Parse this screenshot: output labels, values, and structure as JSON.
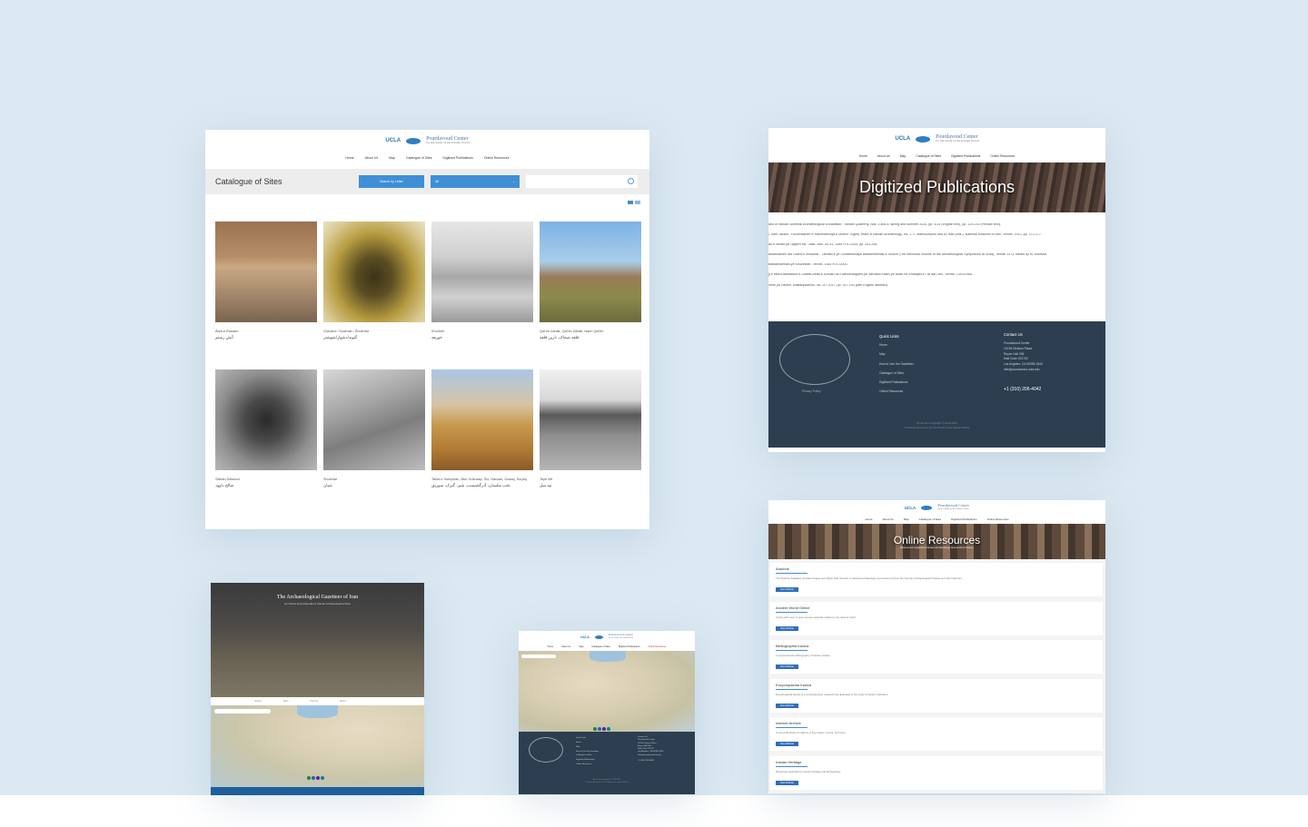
{
  "header": {
    "ucla": "UCLA",
    "center_name": "Pourdavoud Center",
    "center_sub": "for the Study of the Iranian World"
  },
  "nav": [
    "Home",
    "About Us",
    "Map",
    "Catalogue of Sites",
    "Digitized Publications",
    "Online Resources"
  ],
  "catalogue": {
    "title": "Catalogue of Sites",
    "search_by_letter": "Search by Letter",
    "select_value": "All",
    "sites": [
      {
        "en": "Āteš-e Rostam",
        "fa": "آتش رستم"
      },
      {
        "en": "Gotvand / Doshvār / Shushtar",
        "fa": "گتوند/دشوار/شوشتر"
      },
      {
        "en": "Khorheh",
        "fa": "خورهه"
      },
      {
        "en": "Qal‘eh Zahāk, Qal‘eh Zahāk, Narin Qal‘eh",
        "fa": "قلعه ضحاک، نارین قلعه"
      },
      {
        "en": "Sālekh Dāwood",
        "fa": "صالح داوود"
      },
      {
        "en": "Shushtar",
        "fa": "شیان"
      },
      {
        "en": "Takht-e Soleymān, Ātur Gošnasp, Šiz, Ganzak, Gazaq, Surjaq",
        "fa": "تخت سلیمان، آذرگشنسب، شیز، گنزک، سوریق"
      },
      {
        "en": "Tepe Mil",
        "fa": "تپه میل"
      }
    ]
  },
  "publications": {
    "banner": "Digitized Publications",
    "refs": [
      "and of Iranian Scientific Archaeological Excavation,\" Iranian Quarterly, Nos. 3 and 4, spring and summer 2020, pp. 4-25 (English text), pp. 229-233 (Persian text).",
      "i, Sam Javadi, \"Fuzūlmaẓheri-e Hamedānioqā-e Moṭnīk\" Eighty Years of Iranian Archaeology, vol. 1. F. Mansouripoor and M. Bari (eds.), National Museum of Iran, Tehran, 2012, pp. 172-177.",
      "ān-e Mihān-yā Tappeh Mil,\" Asar, Nos. 40-41, 1385 H.S./2006, pp. 201-208.",
      "asfarīnāmeh dar Gāleh-e Shushtar,\" Tāhdād-e ye Gozāreshhāye Bāstānshenāsi-e Shushi (The Memorial Volume of the Archaeological Symposium at Susa), Tehran 1373, edited by M. Mousavi.",
      "Bāstānshenāsi-ye Khuzestān, Tehran, 1382 H.S./2003.",
      "y-e tarikh-tamaddon-e Dowlat-Abād-e Kordān va Kulenhmādjiyeh-ye Sarhadd Kaleh-ye tarikh be-Khalajān-e Tār dar Deh, Tehran, 1392/1968.",
      "ihroe yā Pārseh, Bāstānpazhuhi, No. 20, 2017, pp. 147-150 (with English abstract)."
    ]
  },
  "footer": {
    "privacy": "Privacy Policy",
    "quick_links_title": "Quick Links",
    "quick_links": [
      "Home",
      "Map",
      "How to Use the Gazetteer",
      "Catalogue of Sites",
      "Digitized Publications",
      "Online Resources"
    ],
    "contact_title": "Contact Us",
    "contact_lines": [
      "Pourdavoud Center",
      "10745 Dickson Plaza",
      "Royce Hall 306",
      "Mail Code 021702",
      "Los Angeles, CA 90095-1540",
      "info@pourdavoud.ucla.edu"
    ],
    "phone": "+1 (310) 206-4042",
    "copyright": "All content copyright © 2019-2024",
    "credit": "Pourdavoud Center for the Study of the Iranian World"
  },
  "resources": {
    "banner": "Online Resources",
    "banner_sub": "Resources regarding Iranian archaeology and ancient history",
    "button": "View Website",
    "items": [
      {
        "name": "Arachne",
        "desc": "The Arachne database provides images and object data relevant to classical archaeology and ancient art from the German Archaeological Institute and other partners."
      },
      {
        "name": "Ancient World Online",
        "desc": "A blog with news of open access materials relating to the ancient world."
      },
      {
        "name": "Bibliographia Iranica",
        "desc": "A comprehensive bibliography of Iranian studies."
      },
      {
        "name": "Encyclopaedia Iranica",
        "desc": "Encyclopaedia Iranica is a comprehensive research tool dedicated to the study of Iranian civilization."
      },
      {
        "name": "Internet Archive",
        "desc": "A non-profit library of millions of free books, movies, and more."
      },
      {
        "name": "Iranian Heritage",
        "desc": "Resources dedicated to Iranian heritage and archaeology."
      }
    ]
  },
  "gazetteer": {
    "title": "The Archaeological Gazetteer of Iran",
    "subtitle": "An Online Encyclopedia of Iranian Archaeological Sites",
    "bar_items": [
      "Search",
      "Sites",
      "Periods",
      "About"
    ]
  },
  "colors": {
    "background": "#dce9f2",
    "accent": "#3f8fd6",
    "footer": "#2c3e50"
  }
}
